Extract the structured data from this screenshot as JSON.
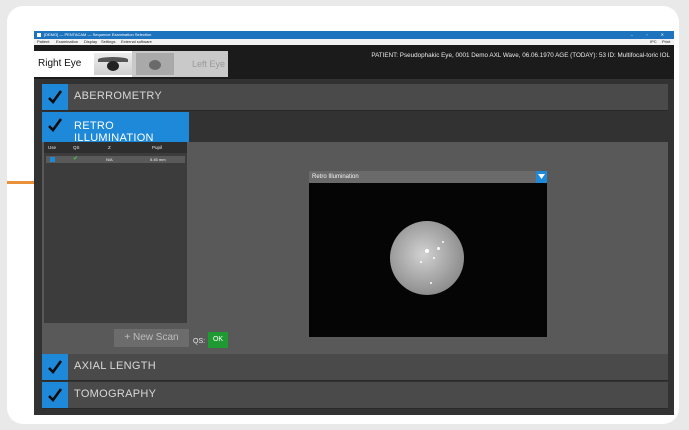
{
  "window": {
    "title": "[DEMO] — PENTACAM — Sequence Examination Selection",
    "controls": "–  ▫  ✕"
  },
  "menubar": {
    "items": [
      "Patient",
      "Examination",
      "Display",
      "Settings",
      "External software"
    ],
    "right_items": [
      "IPC",
      "Print"
    ]
  },
  "eye_tabs": {
    "right": "Right Eye",
    "left": "Left Eye"
  },
  "patient_info": "PATIENT: Pseudophakic Eye, 0001 Demo AXL Wave, 06.06.1970   AGE (TODAY): 53   ID: Multifocal-toric IOL",
  "sections": {
    "aberrometry": "ABERROMETRY",
    "retro_illumination": "RETRO ILLUMINATION",
    "axial_length": "AXIAL LENGTH",
    "tomography": "TOMOGRAPHY"
  },
  "scan_table": {
    "columns": [
      "Use",
      "QS",
      "Z",
      "Pupil"
    ],
    "rows": [
      {
        "z": "N/A",
        "pupil": "5.45 mm"
      }
    ]
  },
  "new_scan_label": "+ New Scan",
  "qs": {
    "label": "QS:",
    "value": "OK"
  },
  "viewer": {
    "dropdown_value": "Retro Illumination"
  },
  "colors": {
    "accent_blue": "#1e88d9",
    "ok_green": "#1f9a33",
    "dark_bg": "#323232"
  }
}
